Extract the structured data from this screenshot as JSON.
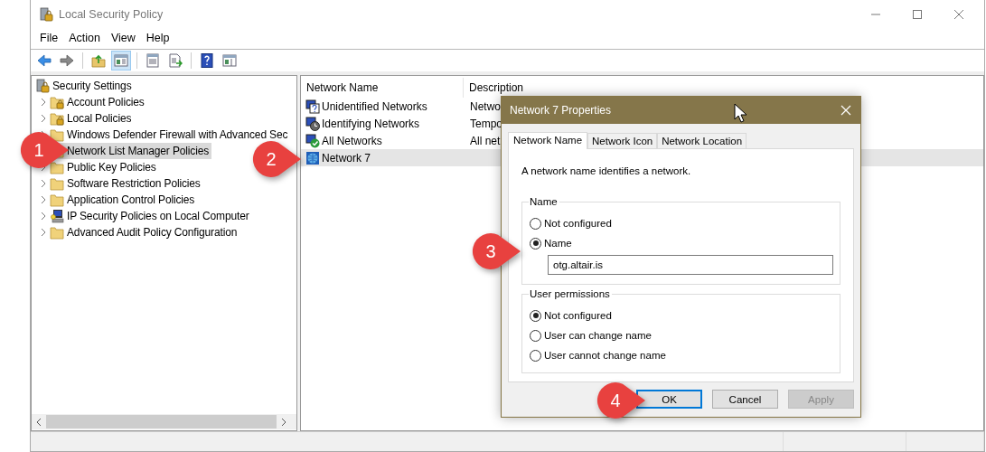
{
  "window": {
    "title": "Local Security Policy"
  },
  "menu": [
    "File",
    "Action",
    "View",
    "Help"
  ],
  "toolbar": [
    {
      "kind": "back",
      "pressed": false
    },
    {
      "kind": "forward",
      "pressed": false
    },
    {
      "kind": "sep"
    },
    {
      "kind": "up",
      "pressed": false
    },
    {
      "kind": "tree",
      "pressed": true
    },
    {
      "kind": "sep"
    },
    {
      "kind": "properties",
      "pressed": false
    },
    {
      "kind": "export",
      "pressed": false
    },
    {
      "kind": "sep"
    },
    {
      "kind": "help",
      "pressed": false
    },
    {
      "kind": "pane",
      "pressed": false
    }
  ],
  "tree": [
    {
      "label": "Security Settings",
      "kind": "server",
      "selected": false,
      "children": [
        {
          "label": "Account Policies",
          "kind": "lockfolder",
          "expanded": false,
          "selected": false
        },
        {
          "label": "Local Policies",
          "kind": "lockfolder",
          "expanded": false,
          "selected": false
        },
        {
          "label": "Windows Defender Firewall with Advanced Sec",
          "kind": "folder",
          "expanded": false,
          "selected": false
        },
        {
          "label": "Network List Manager Policies",
          "kind": "folder",
          "selected": true
        },
        {
          "label": "Public Key Policies",
          "kind": "folder",
          "expanded": false,
          "selected": false
        },
        {
          "label": "Software Restriction Policies",
          "kind": "folder",
          "expanded": false,
          "selected": false
        },
        {
          "label": "Application Control Policies",
          "kind": "folder",
          "expanded": false,
          "selected": false
        },
        {
          "label": "IP Security Policies on Local Computer",
          "kind": "ipsec",
          "expanded": false,
          "selected": false
        },
        {
          "label": "Advanced Audit Policy Configuration",
          "kind": "folder",
          "expanded": false,
          "selected": false
        }
      ]
    }
  ],
  "list": {
    "columns": [
      "Network Name",
      "Description"
    ],
    "rows": [
      {
        "name": "Unidentified Networks",
        "description": "Netwo",
        "kind": "question",
        "selected": false
      },
      {
        "name": "Identifying Networks",
        "description": "Tempo",
        "kind": "clock",
        "selected": false
      },
      {
        "name": "All Networks",
        "description": "All net",
        "kind": "check",
        "selected": false
      },
      {
        "name": "Network 7",
        "kind": "globe",
        "selected": true
      }
    ]
  },
  "dialog": {
    "title": "Network 7 Properties",
    "tabs": [
      {
        "label": "Network Name",
        "selected": true
      },
      {
        "label": "Network Icon",
        "selected": false
      },
      {
        "label": "Network Location",
        "selected": false
      }
    ],
    "intro": "A network name identifies a network.",
    "groups": [
      {
        "title": "Name",
        "options": [
          {
            "label": "Not configured",
            "selected": false
          },
          {
            "label": "Name",
            "selected": true
          }
        ],
        "value": "otg.altair.is"
      },
      {
        "title": "User permissions",
        "options": [
          {
            "label": "Not configured",
            "selected": true
          },
          {
            "label": "User can change name",
            "selected": false
          },
          {
            "label": "User cannot change name",
            "selected": false
          }
        ]
      }
    ],
    "buttons": [
      {
        "label": "OK",
        "default": true,
        "disabled": false
      },
      {
        "label": "Cancel",
        "default": false,
        "disabled": false
      },
      {
        "label": "Apply",
        "default": false,
        "disabled": true
      }
    ]
  },
  "callouts": [
    "1",
    "2",
    "3",
    "4"
  ]
}
